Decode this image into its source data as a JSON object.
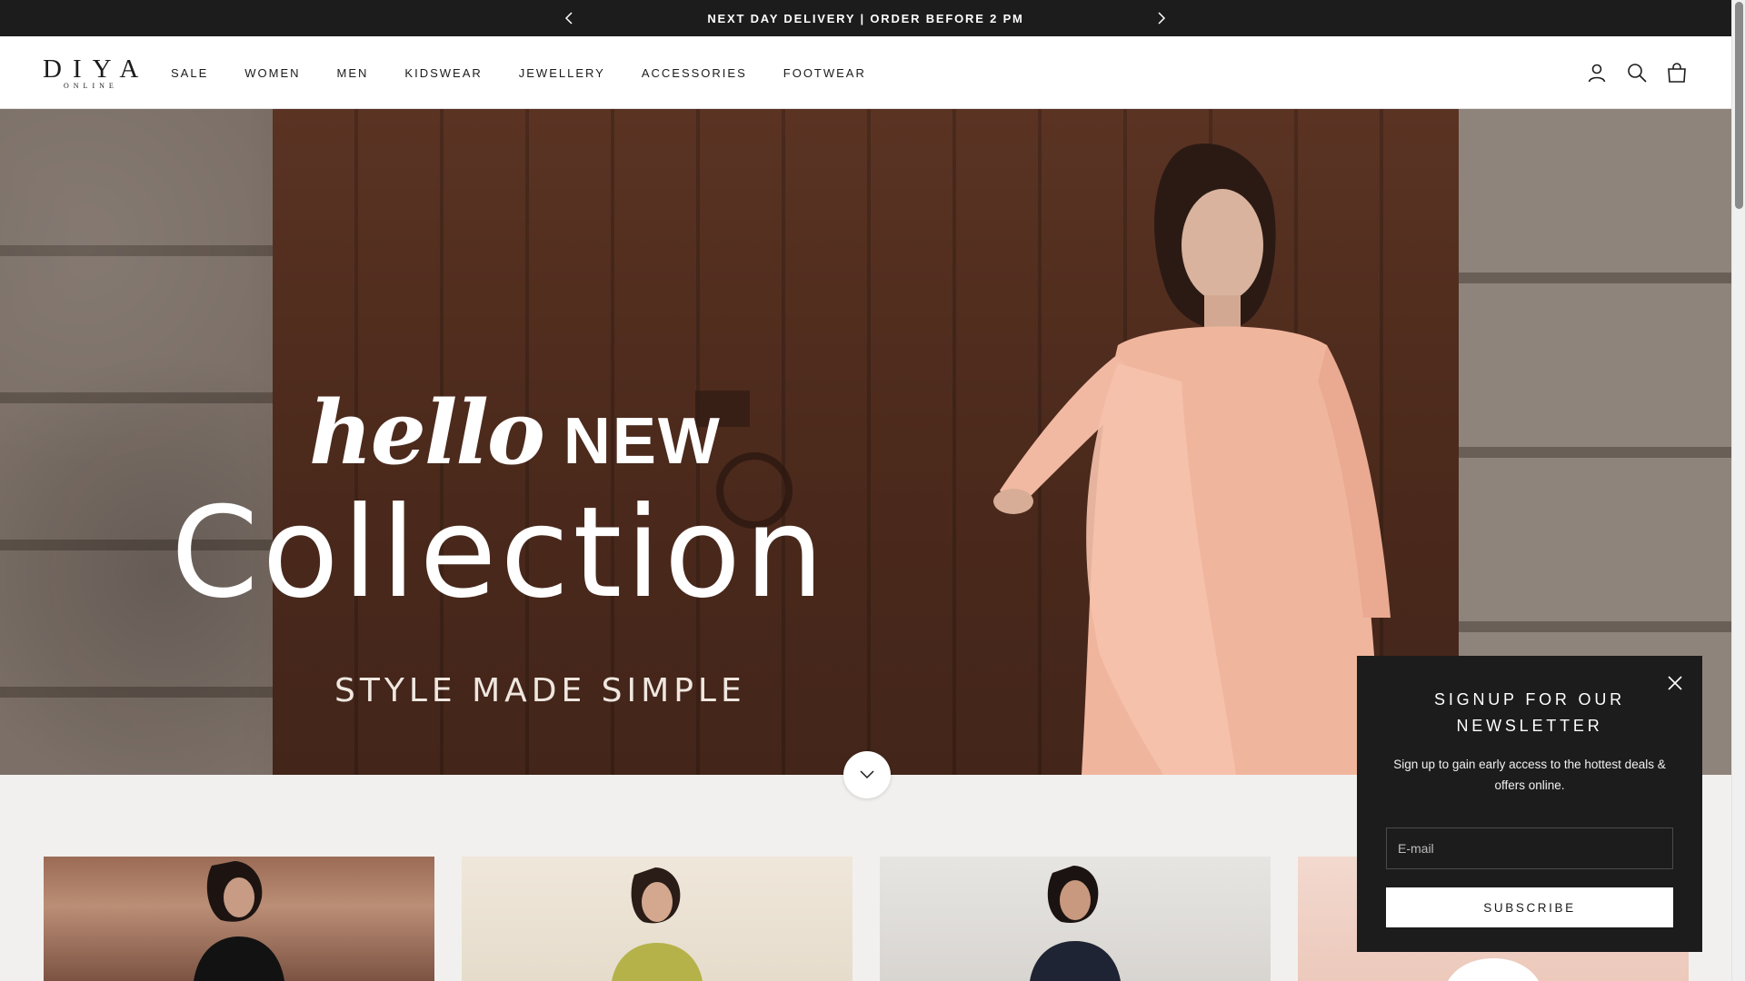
{
  "announcement": {
    "text": "NEXT DAY DELIVERY | ORDER BEFORE 2 PM",
    "prev_icon": "chevron-left-icon",
    "next_icon": "chevron-right-icon"
  },
  "header": {
    "logo_main": "DIYA",
    "logo_sub": "ONLINE",
    "nav": [
      "SALE",
      "WOMEN",
      "MEN",
      "KIDSWEAR",
      "JEWELLERY",
      "ACCESSORIES",
      "FOOTWEAR"
    ],
    "icons": [
      "account-icon",
      "search-icon",
      "bag-icon"
    ]
  },
  "hero": {
    "line1_script": "hello",
    "line1_bold": "NEW",
    "line2": "Collection",
    "tagline": "STYLE MADE SIMPLE",
    "scroll_icon": "chevron-down-icon"
  },
  "newsletter": {
    "title_line1": "SIGNUP FOR OUR",
    "title_line2": "NEWSLETTER",
    "description": "Sign up to gain early access to the hottest deals & offers online.",
    "email_placeholder": "E-mail",
    "subscribe_label": "SUBSCRIBE",
    "close_icon": "close-icon"
  },
  "colors": {
    "announcement_bg": "#1c1c1c",
    "header_bg": "#ffffff",
    "popup_bg": "#1c1c1c",
    "page_bg": "#f1f0ee"
  }
}
